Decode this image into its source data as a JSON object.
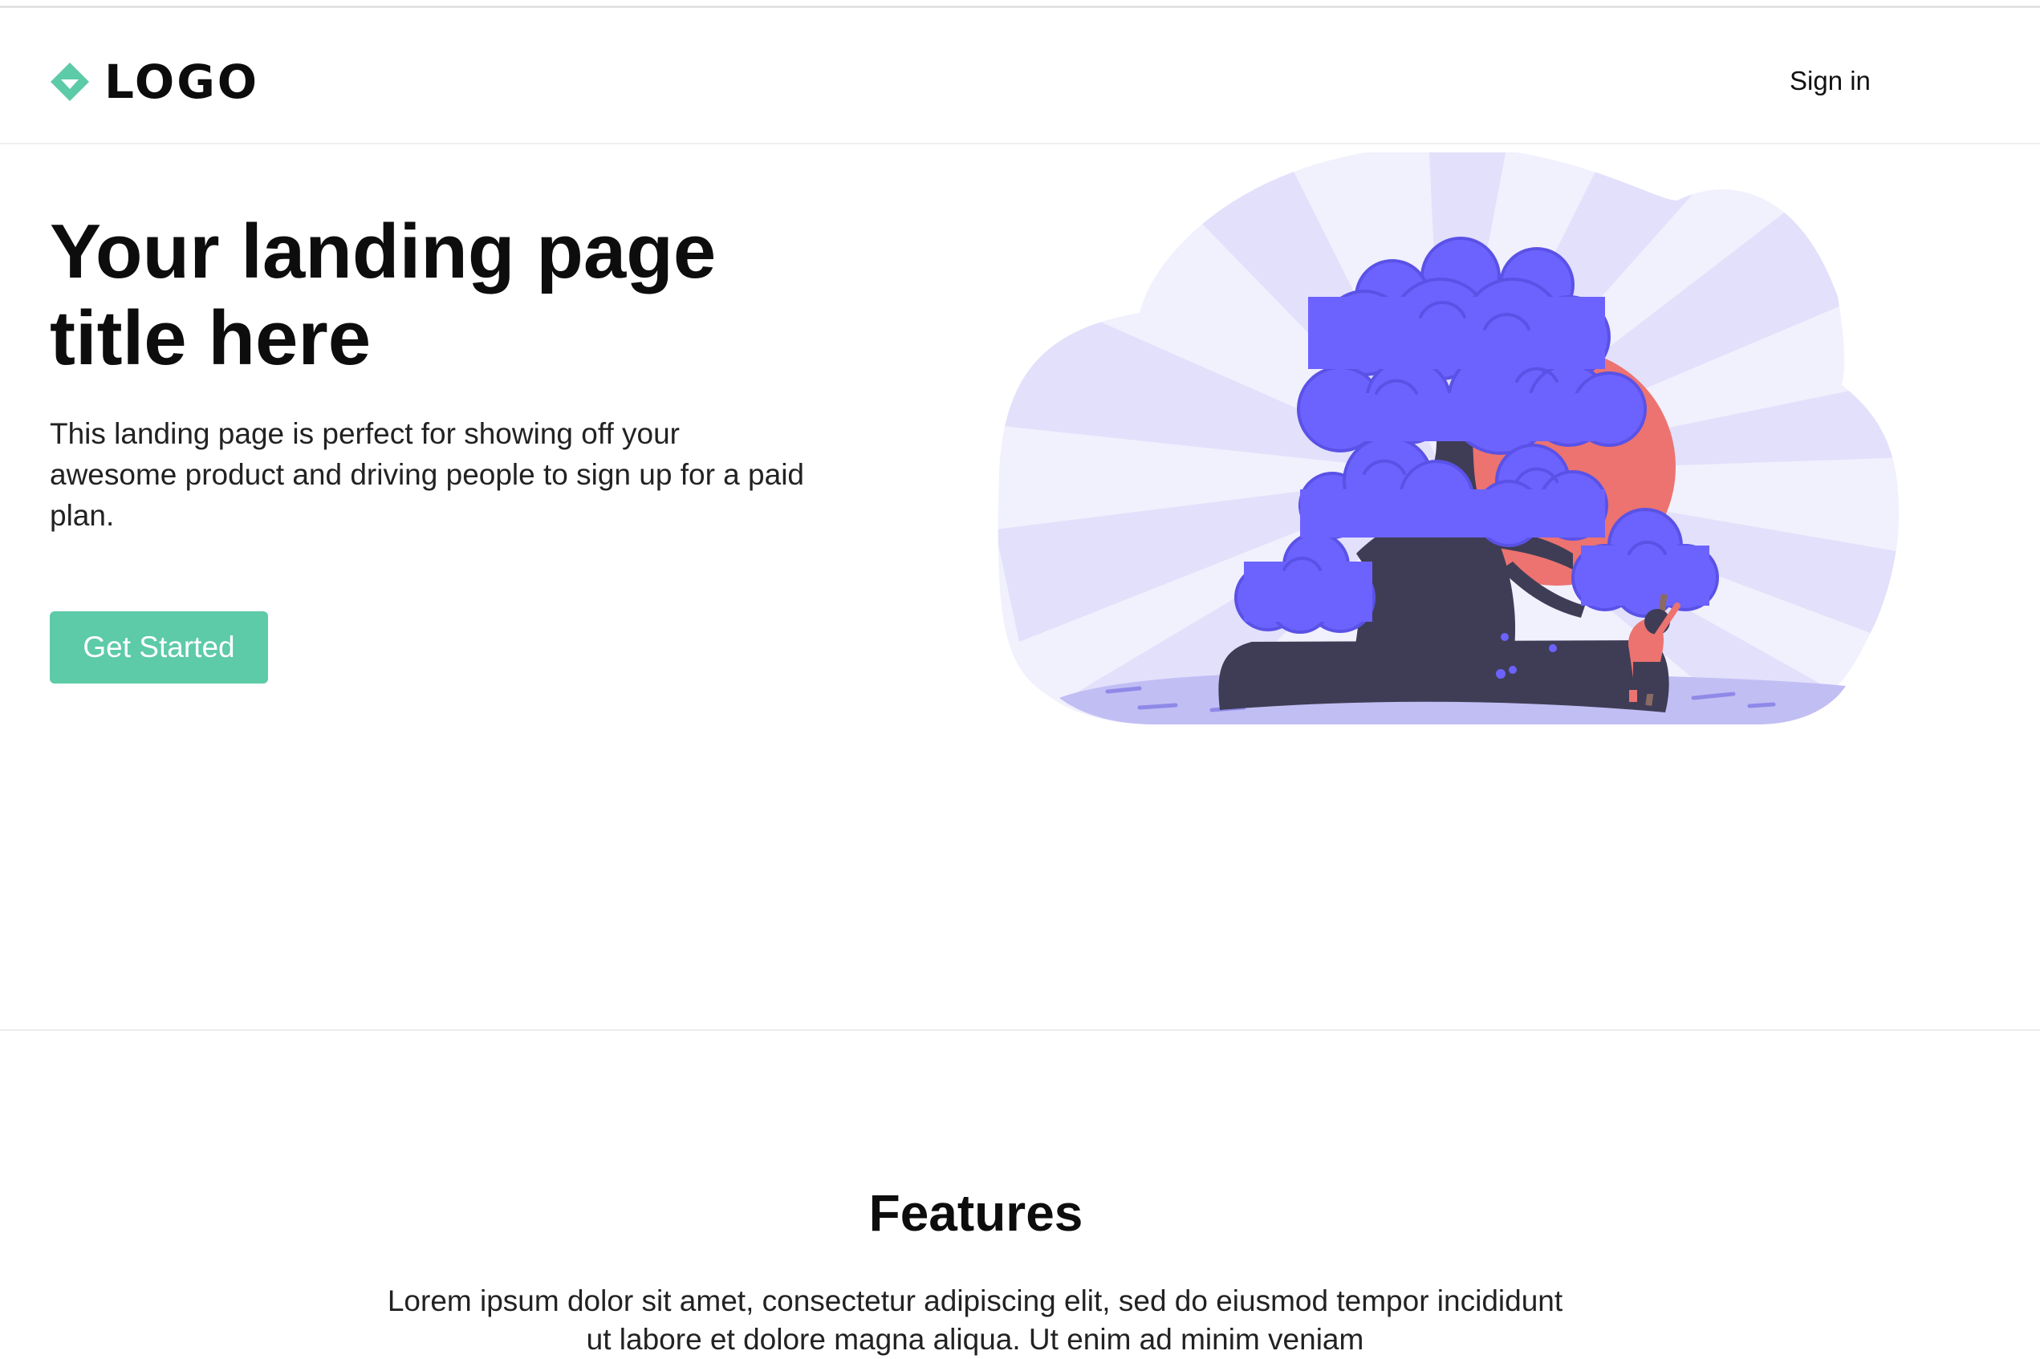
{
  "header": {
    "logo_text": "LOGO",
    "signin_label": "Sign in"
  },
  "hero": {
    "title": "Your landing page title here",
    "description": "This landing page is perfect for showing off your awesome product and driving people to sign up for a paid plan.",
    "cta_label": "Get Started",
    "illustration": "bonsai-tree-sunrise-illustration"
  },
  "features": {
    "title": "Features",
    "body": "Lorem ipsum dolor sit amet, consectetur adipiscing elit, sed do eiusmod tempor incididunt ut labore et dolore magna aliqua. Ut enim ad minim veniam"
  },
  "colors": {
    "accent": "#5dcaa8",
    "tree": "#6c63ff",
    "sun": "#ec7370",
    "trunk": "#3f3d56"
  }
}
